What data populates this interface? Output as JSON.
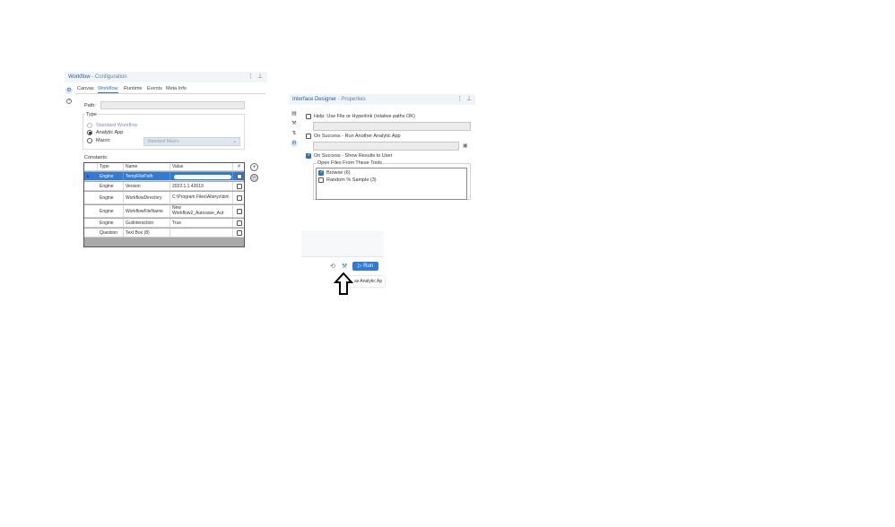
{
  "workflow_panel": {
    "title": "Workflow",
    "subtitle": "- Configuration",
    "tabs": [
      "Canvas",
      "Workflow",
      "Runtime",
      "Events",
      "Meta Info"
    ],
    "active_tab": "Workflow",
    "path_label": "Path:",
    "path_value": "",
    "type_label": "Type",
    "radios": [
      {
        "label": "Standard Workflow",
        "checked": false,
        "disabled": true
      },
      {
        "label": "Analytic App",
        "checked": true,
        "disabled": false
      },
      {
        "label": "Macro:",
        "checked": false,
        "disabled": false
      }
    ],
    "macro_select_value": "Standard Macro",
    "constants_label": "Constants:",
    "table": {
      "headers": [
        "Type",
        "Name",
        "Value",
        "#"
      ],
      "rows": [
        {
          "type": "Engine",
          "name": "TempFilePath",
          "value": "",
          "selected": true
        },
        {
          "type": "Engine",
          "name": "Version",
          "value": "2022.1.1.42619",
          "selected": false
        },
        {
          "type": "Engine",
          "name": "WorkflowDirectory",
          "value": "C:\\Program Files\\Alteryx\\bin\\",
          "selected": false
        },
        {
          "type": "Engine",
          "name": "WorkflowFileName",
          "value": "New Workflow2_Autosave_Aut",
          "selected": false
        },
        {
          "type": "Engine",
          "name": "GuiInteraction",
          "value": "True",
          "selected": false
        },
        {
          "type": "Question",
          "name": "Text Box (8)",
          "value": "",
          "selected": false
        }
      ]
    }
  },
  "interface_panel": {
    "title": "Interface Designer",
    "subtitle": "- Properties",
    "help_label": "Help: Use File or Hyperlink (relative paths OK)",
    "help_checked": false,
    "run_another_label": "On Success - Run Another Analytic App",
    "run_another_checked": false,
    "show_results_label": "On Success - Show Results to User",
    "show_results_checked": true,
    "open_files_label": "Open Files From These Tools",
    "open_files_items": [
      {
        "label": "Browse (6)",
        "checked": true
      },
      {
        "label": "Random % Sample (3)",
        "checked": false
      }
    ]
  },
  "run_bar": {
    "run_label": "Run",
    "tooltip_text": "as Analytic Ap"
  },
  "colors": {
    "accent": "#2f7bd6",
    "header_bg": "#f2f5f8",
    "table_fill": "#a9a9a9"
  }
}
